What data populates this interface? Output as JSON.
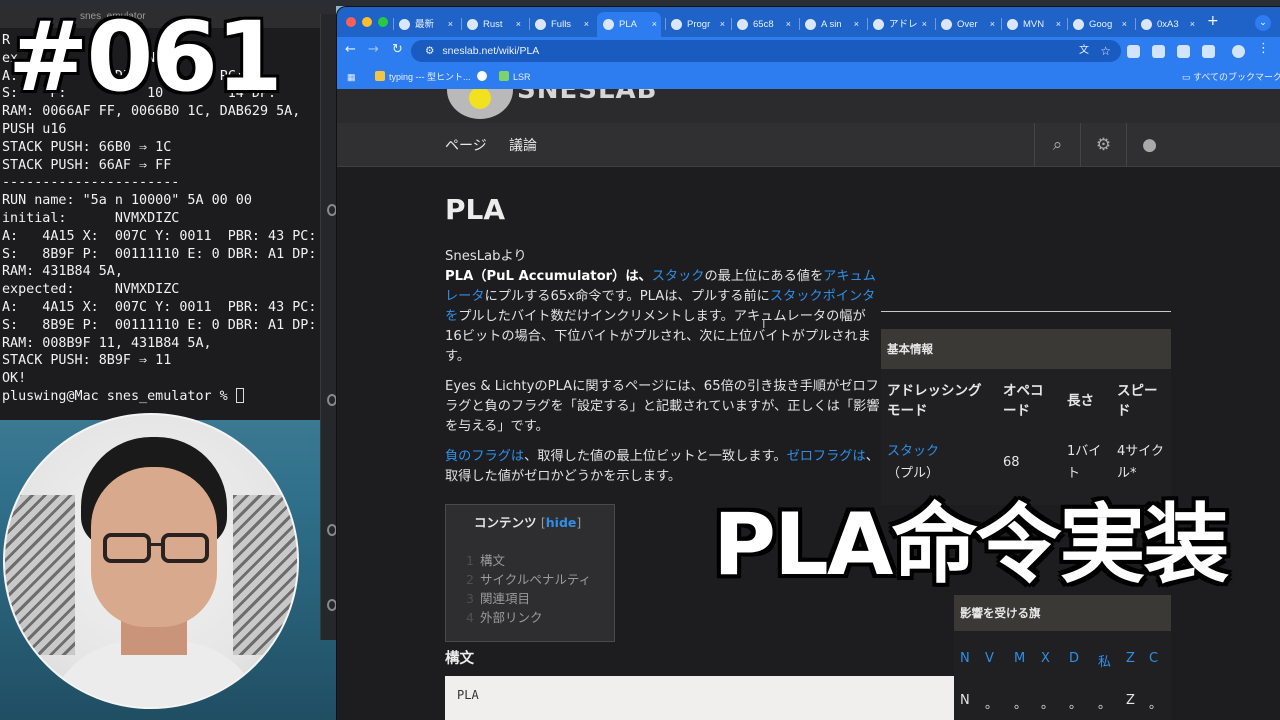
{
  "terminal": {
    "title": "snes_emulator",
    "lines": [
      "R",
      "ex                NVMX",
      "A:            DI        DA PC:",
      "S:    P:          10        14 DP:",
      "RAM: 0066AF FF, 0066B0 1C, DAB629 5A,",
      "PUSH u16",
      "STACK PUSH: 66B0 ⇒ 1C",
      "STACK PUSH: 66AF ⇒ FF",
      "----------------------",
      "RUN name: \"5a n 10000\" 5A 00 00",
      "initial:      NVMXDIZC",
      "A:   4A15 X:  007C Y: 0011  PBR: 43 PC:",
      "S:   8B9F P:  00111110 E: 0 DBR: A1 DP:",
      "RAM: 431B84 5A,",
      "expected:     NVMXDIZC",
      "A:   4A15 X:  007C Y: 0011  PBR: 43 PC:",
      "S:   8B9E P:  00111110 E: 0 DBR: A1 DP:",
      "RAM: 008B9F 11, 431B84 5A,",
      "STACK PUSH: 8B9F ⇒ 11",
      "OK!",
      "pluswing@Mac snes_emulator % "
    ]
  },
  "browser": {
    "tabs": [
      {
        "label": "最新",
        "icon": "github-icon"
      },
      {
        "label": "Rust",
        "icon": "rust-icon"
      },
      {
        "label": "Fulls",
        "icon": "globe-icon"
      },
      {
        "label": "PLA",
        "icon": "sneslab-icon",
        "active": true
      },
      {
        "label": "Progr",
        "icon": "book-icon"
      },
      {
        "label": "65c8",
        "icon": "globe-icon"
      },
      {
        "label": "A sin",
        "icon": "globe-icon"
      },
      {
        "label": "アドレ",
        "icon": "globe-icon"
      },
      {
        "label": "Over",
        "icon": "globe-icon"
      },
      {
        "label": "MVN",
        "icon": "globe-icon"
      },
      {
        "label": "Goog",
        "icon": "globe-icon"
      },
      {
        "label": "0xA3",
        "icon": "google-icon"
      }
    ],
    "url": "sneslab.net/wiki/PLA",
    "bookmarks": [
      {
        "label": "typing --- 型ヒント..."
      },
      {
        "label": ""
      },
      {
        "label": "LSR"
      }
    ],
    "all_bookmarks": "すべてのブックマーク"
  },
  "site": {
    "logo": "SNESLAB",
    "nav": [
      "ページ",
      "議論"
    ],
    "title": "PLA",
    "from": "SnesLabより",
    "para1": {
      "lead": "PLA（PuL Accumulator）は、",
      "link1": "スタック",
      "mid1": "の最上位にある値を",
      "link2": "アキュムレータ",
      "mid2": "にプルする65x命令です。PLAは、プルする前に",
      "link3": "スタックポインタを",
      "rest": "プルしたバイト数だけインクリメントします。アキュムレータの幅が16ビットの場合、下位バイトがプルされ、次に上位バイトがプルされます。"
    },
    "para2": "Eyes & LichtyのPLAに関するページには、65倍の引き抜き手順がゼロフラグと負のフラグを「設定する」と記載されていますが、正しくは「影響を与える」です。",
    "para3": {
      "link1": "負のフラグは",
      "mid": "、取得した値の最上位ビットと一致します。",
      "link2": "ゼロフラグは",
      "rest": "、取得した値がゼロかどうかを示します。"
    },
    "toc": {
      "title": "コンテンツ",
      "hide_open": "[",
      "hide": "hide",
      "hide_close": "]",
      "items": [
        {
          "num": "1",
          "label": "構文"
        },
        {
          "num": "2",
          "label": "サイクルペナルティ"
        },
        {
          "num": "3",
          "label": "関連項目"
        },
        {
          "num": "4",
          "label": "外部リンク"
        }
      ]
    },
    "section_syntax": "構文",
    "code": "PLA",
    "infobox": {
      "title": "基本情報",
      "headers": [
        "アドレッシングモード",
        "オペコード",
        "長さ",
        "スピード"
      ],
      "row": {
        "mode_link": "スタック",
        "mode_rest": "（プル）",
        "opcode": "68",
        "length": "1バイト",
        "speed": "4サイクル*"
      }
    },
    "flags": {
      "title": "影響を受ける旗",
      "names": [
        "N",
        "V",
        "M",
        "X",
        "D",
        "私",
        "Z",
        "C"
      ],
      "values": [
        "N",
        "。",
        "。",
        "。",
        "。",
        "。",
        "Z",
        "。"
      ]
    }
  },
  "overlay": {
    "episode": "#061",
    "title": "PLA命令実装"
  },
  "colors": {
    "tabbar": "#1f63c9",
    "link": "#2f8fe8",
    "page_bg": "#1d1d1f"
  }
}
